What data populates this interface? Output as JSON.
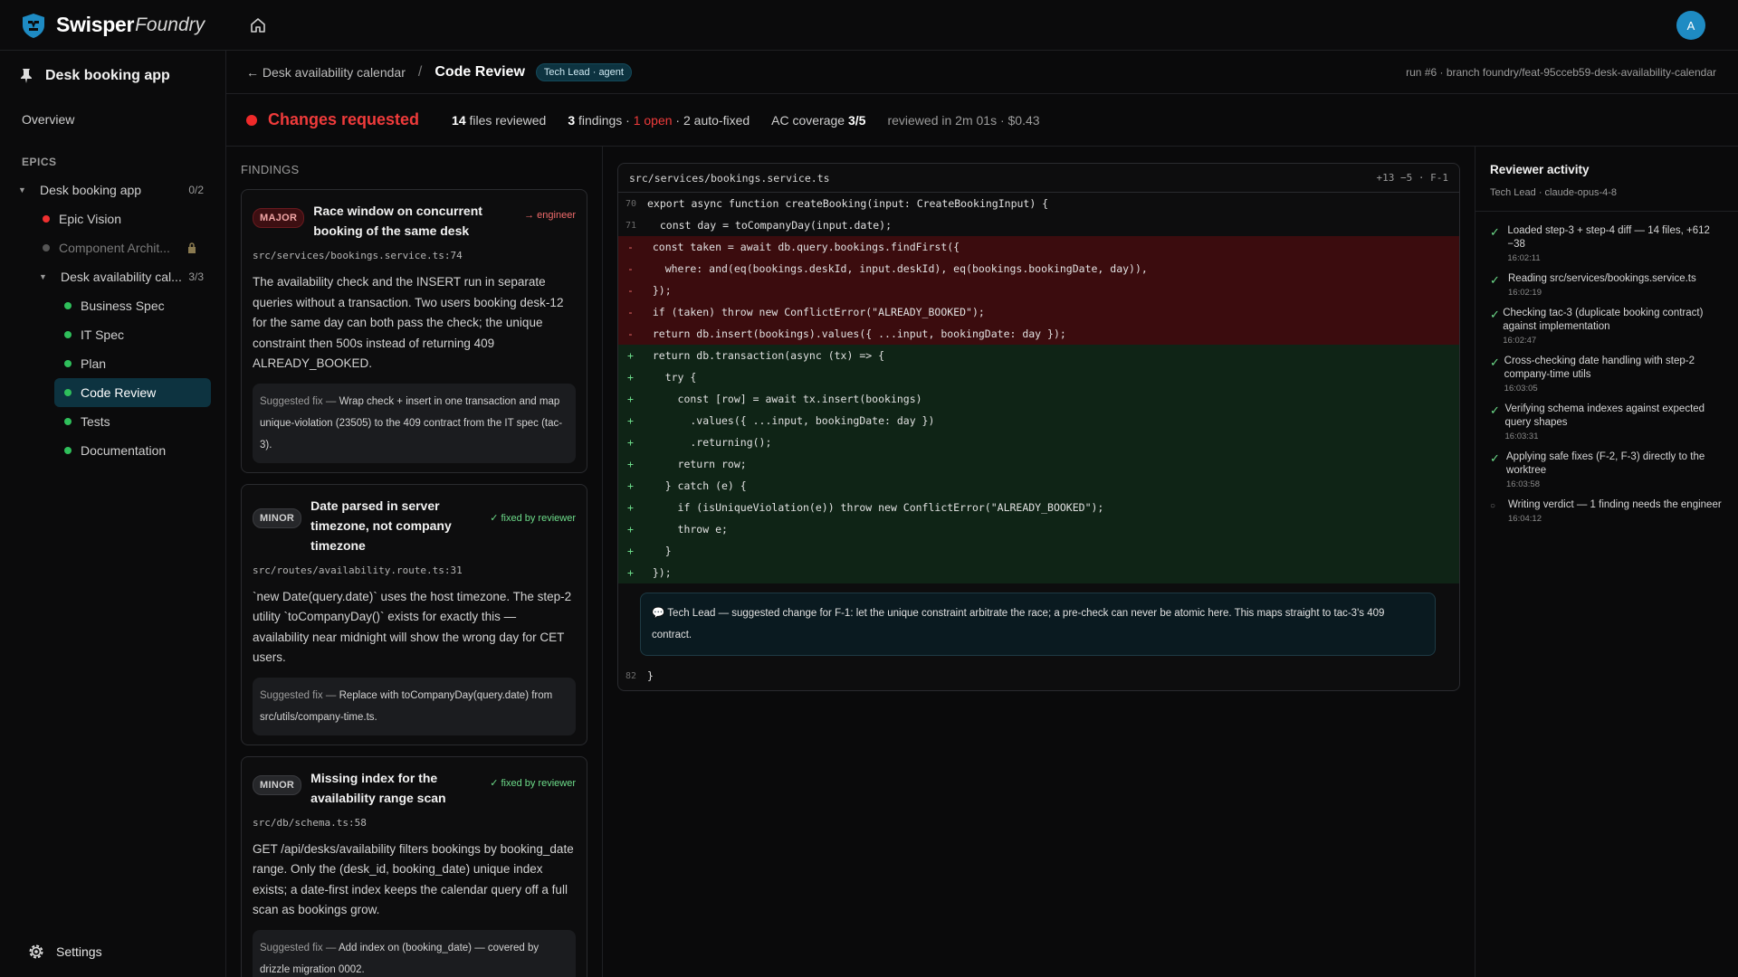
{
  "app": {
    "brand_a": "Swisper",
    "brand_b": "Foundry",
    "avatar": "A"
  },
  "sidebar": {
    "project": "Desk booking app",
    "overview": "Overview",
    "epics_label": "EPICS",
    "epic": {
      "label": "Desk booking app",
      "count": "0/2"
    },
    "items": [
      {
        "label": "Epic Vision",
        "color": "#ef3030"
      },
      {
        "label": "Component Archit...",
        "color": "#555"
      }
    ],
    "sub_epic": {
      "label": "Desk availability cal...",
      "count": "3/3"
    },
    "sub_items": [
      {
        "label": "Business Spec",
        "color": "#2fbf5b"
      },
      {
        "label": "IT Spec",
        "color": "#2fbf5b"
      },
      {
        "label": "Plan",
        "color": "#2fbf5b"
      },
      {
        "label": "Code Review",
        "color": "#2fbf5b"
      },
      {
        "label": "Tests",
        "color": "#2fbf5b"
      },
      {
        "label": "Documentation",
        "color": "#2fbf5b"
      }
    ],
    "settings": "Settings"
  },
  "header": {
    "back": "← Desk availability calendar",
    "sep": "/",
    "current": "Code Review",
    "badge": "Tech Lead · agent",
    "run": "run #6 · branch foundry/feat-95cceb59-desk-availability-calendar"
  },
  "status": {
    "verdict": "Changes requested",
    "files_n": "14",
    "files_t": " files reviewed",
    "findings_n": "3",
    "findings_t": " findings · ",
    "open": "1 open",
    "autofix": " · 2 auto-fixed",
    "ac_t": "AC coverage ",
    "ac_n": "3/5",
    "reviewed": "reviewed in 2m 01s · $0.43"
  },
  "findings": {
    "label": "FINDINGS",
    "cards": [
      {
        "sev": "MAJOR",
        "title": "Race window on concurrent booking of the same desk",
        "tag": "→ engineer",
        "file": "src/services/bookings.service.ts:74",
        "desc": "The availability check and the INSERT run in separate queries without a transaction. Two users booking desk-12 for the same day can both pass the check; the unique constraint then 500s instead of returning 409 ALREADY_BOOKED.",
        "fix_pre": "Suggested fix — ",
        "fix": "Wrap check + insert in one transaction and map unique-violation (23505) to the 409 contract from the IT spec (tac-3)."
      },
      {
        "sev": "MINOR",
        "title": "Date parsed in server timezone, not company timezone",
        "tag": "✓ fixed by reviewer",
        "file": "src/routes/availability.route.ts:31",
        "desc": "`new Date(query.date)` uses the host timezone. The step-2 utility `toCompanyDay()` exists for exactly this — availability near midnight will show the wrong day for CET users.",
        "fix_pre": "Suggested fix — ",
        "fix": "Replace with toCompanyDay(query.date) from src/utils/company-time.ts."
      },
      {
        "sev": "MINOR",
        "title": "Missing index for the availability range scan",
        "tag": "✓ fixed by reviewer",
        "file": "src/db/schema.ts:58",
        "desc": "GET /api/desks/availability filters bookings by booking_date range. Only the (desk_id, booking_date) unique index exists; a date-first index keeps the calendar query off a full scan as bookings grow.",
        "fix_pre": "Suggested fix — ",
        "fix": "Add index on (booking_date) — covered by drizzle migration 0002."
      }
    ]
  },
  "diff": {
    "file": "src/services/bookings.service.ts",
    "stats": "+13 −5 · F-1",
    "lines": [
      {
        "t": "ctx",
        "n": "70",
        "s": "",
        "c": "export async function createBooking(input: CreateBookingInput) {"
      },
      {
        "t": "ctx",
        "n": "71",
        "s": "",
        "c": "  const day = toCompanyDay(input.date);"
      },
      {
        "t": "del",
        "n": "",
        "s": "-",
        "c": "  const taken = await db.query.bookings.findFirst({"
      },
      {
        "t": "del",
        "n": "",
        "s": "-",
        "c": "    where: and(eq(bookings.deskId, input.deskId), eq(bookings.bookingDate, day)),"
      },
      {
        "t": "del",
        "n": "",
        "s": "-",
        "c": "  });"
      },
      {
        "t": "del",
        "n": "",
        "s": "-",
        "c": "  if (taken) throw new ConflictError(\"ALREADY_BOOKED\");"
      },
      {
        "t": "del",
        "n": "",
        "s": "-",
        "c": "  return db.insert(bookings).values({ ...input, bookingDate: day });"
      },
      {
        "t": "add",
        "n": "",
        "s": "+",
        "c": "  return db.transaction(async (tx) => {"
      },
      {
        "t": "add",
        "n": "",
        "s": "+",
        "c": "    try {"
      },
      {
        "t": "add",
        "n": "",
        "s": "+",
        "c": "      const [row] = await tx.insert(bookings)"
      },
      {
        "t": "add",
        "n": "",
        "s": "+",
        "c": "        .values({ ...input, bookingDate: day })"
      },
      {
        "t": "add",
        "n": "",
        "s": "+",
        "c": "        .returning();"
      },
      {
        "t": "add",
        "n": "",
        "s": "+",
        "c": "      return row;"
      },
      {
        "t": "add",
        "n": "",
        "s": "+",
        "c": "    } catch (e) {"
      },
      {
        "t": "add",
        "n": "",
        "s": "+",
        "c": "      if (isUniqueViolation(e)) throw new ConflictError(\"ALREADY_BOOKED\");"
      },
      {
        "t": "add",
        "n": "",
        "s": "+",
        "c": "      throw e;"
      },
      {
        "t": "add",
        "n": "",
        "s": "+",
        "c": "    }"
      },
      {
        "t": "add",
        "n": "",
        "s": "+",
        "c": "  });"
      }
    ],
    "comment": "💬 Tech Lead — suggested change for F-1: let the unique constraint arbitrate the race; a pre-check can never be atomic here. This maps straight to tac-3's 409 contract.",
    "last_no": "82",
    "last_code": "}"
  },
  "activity": {
    "title": "Reviewer activity",
    "sub": "Tech Lead · claude-opus-4-8",
    "items": [
      {
        "done": true,
        "text": "Loaded step-3 + step-4 diff — 14 files, +612 −38",
        "time": "16:02:11"
      },
      {
        "done": true,
        "text": "Reading src/services/bookings.service.ts",
        "time": "16:02:19"
      },
      {
        "done": true,
        "text": "Checking tac-3 (duplicate booking contract) against implementation",
        "time": "16:02:47"
      },
      {
        "done": true,
        "text": "Cross-checking date handling with step-2 company-time utils",
        "time": "16:03:05"
      },
      {
        "done": true,
        "text": "Verifying schema indexes against expected query shapes",
        "time": "16:03:31"
      },
      {
        "done": true,
        "text": "Applying safe fixes (F-2, F-3) directly to the worktree",
        "time": "16:03:58"
      },
      {
        "done": false,
        "text": "Writing verdict — 1 finding needs the engineer",
        "time": "16:04:12"
      }
    ]
  }
}
